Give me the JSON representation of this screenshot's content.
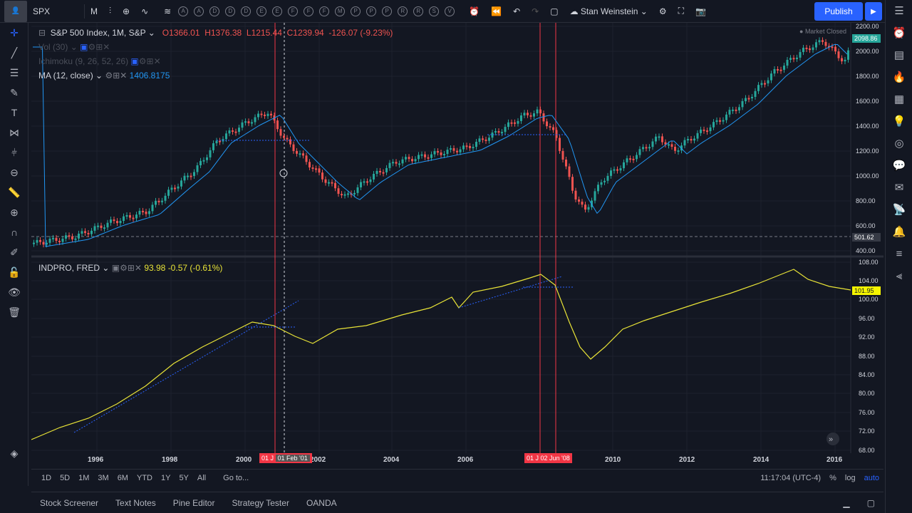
{
  "toolbar": {
    "symbol": "SPX",
    "interval": "M",
    "user": "Stan Weinstein",
    "publish": "Publish"
  },
  "main": {
    "title": "S&P 500 Index, 1M, S&P",
    "open": "O1366.01",
    "high": "H1376.38",
    "low": "L1215.44",
    "close": "C1239.94",
    "change": "-126.07 (-9.23%)",
    "vol": "Vol (30)",
    "ichimoku": "Ichimoku (9, 26, 52, 26)",
    "ma": "MA (12, close)",
    "ma_value": "1406.8175",
    "status": "Market Closed",
    "last_price": "2098.86",
    "crosshair_price": "501.62",
    "yticks": [
      "2200.00",
      "2000.00",
      "1800.00",
      "1600.00",
      "1400.00",
      "1200.00",
      "1000.00",
      "800.00",
      "600.00",
      "400.00"
    ]
  },
  "sub": {
    "title": "INDPRO, FRED",
    "value": "93.98",
    "change": "-0.57 (-0.61%)",
    "last": "101.95",
    "yticks": [
      "108.00",
      "104.00",
      "100.00",
      "96.00",
      "92.00",
      "88.00",
      "84.00",
      "80.00",
      "76.00",
      "72.00",
      "68.00"
    ]
  },
  "xaxis": {
    "labels": [
      "1996",
      "1998",
      "2000",
      "2002",
      "2004",
      "2006",
      "2010",
      "2012",
      "2014",
      "2016"
    ],
    "tag1a": "01 J",
    "tag1b": "01 Feb '01",
    "tag2a": "01 J",
    "tag2b": "02 Jun '08"
  },
  "ranges": [
    "1D",
    "5D",
    "1M",
    "3M",
    "6M",
    "YTD",
    "1Y",
    "5Y",
    "All",
    "Go to..."
  ],
  "time": "11:17:04 (UTC-4)",
  "scale": [
    "%",
    "log",
    "auto"
  ],
  "footer": [
    "Stock Screener",
    "Text Notes",
    "Pine Editor",
    "Strategy Tester",
    "OANDA"
  ],
  "colors": {
    "up": "#26a69a",
    "down": "#ef5350",
    "ma": "#2196f3",
    "indpro": "#e8e337",
    "vline": "#f23645"
  }
}
